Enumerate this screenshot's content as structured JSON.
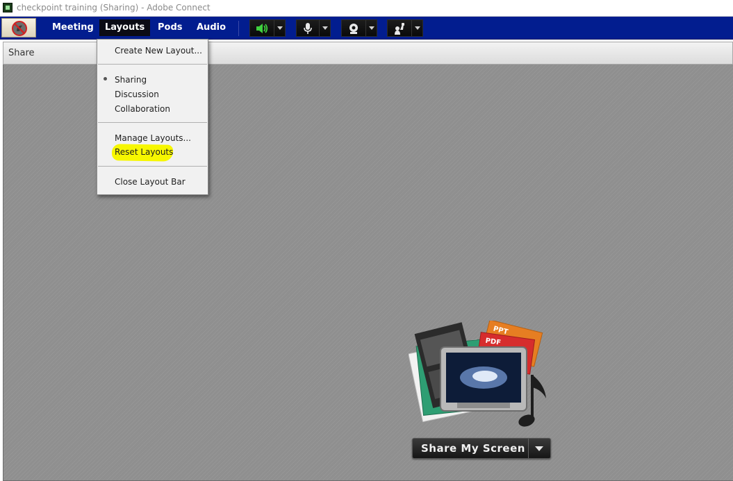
{
  "window": {
    "title": "checkpoint training (Sharing) - Adobe Connect",
    "icon": "adobe-connect-app-icon"
  },
  "menubar": {
    "status_icon": "no-status-icon",
    "items": [
      {
        "label": "Meeting",
        "active": false
      },
      {
        "label": "Layouts",
        "active": true
      },
      {
        "label": "Pods",
        "active": false
      },
      {
        "label": "Audio",
        "active": false
      }
    ],
    "tools": [
      {
        "icon": "speaker-icon",
        "color": "#3fd13f"
      },
      {
        "icon": "microphone-icon",
        "color": "#e8e8e8"
      },
      {
        "icon": "webcam-icon",
        "color": "#e8e8e8"
      },
      {
        "icon": "raise-hand-icon",
        "color": "#e8e8e8"
      }
    ]
  },
  "layouts_menu": {
    "create_new": "Create New Layout...",
    "layouts": [
      {
        "label": "Sharing",
        "selected": true
      },
      {
        "label": "Discussion",
        "selected": false
      },
      {
        "label": "Collaboration",
        "selected": false
      }
    ],
    "manage": "Manage Layouts...",
    "reset": "Reset Layouts",
    "close_bar": "Close Layout Bar",
    "highlight_color": "#f7f700"
  },
  "share_pod": {
    "title": "Share",
    "button_label": "Share My Screen",
    "art_tags": [
      "PPT",
      "PDF"
    ]
  }
}
